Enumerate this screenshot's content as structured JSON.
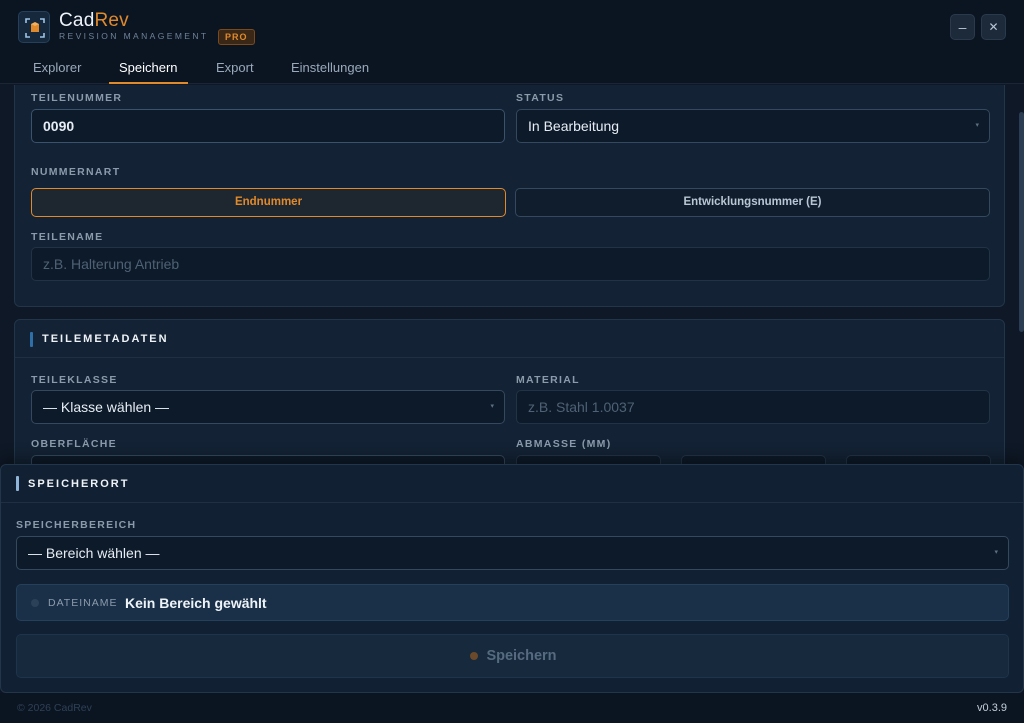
{
  "app": {
    "name_primary": "Cad",
    "name_accent": "Rev",
    "subtitle": "REVISION MANAGEMENT",
    "badge": "PRO"
  },
  "window": {
    "minimize": "–",
    "close": "✕"
  },
  "tabs": [
    {
      "label": "Explorer",
      "active": false
    },
    {
      "label": "Speichern",
      "active": true
    },
    {
      "label": "Export",
      "active": false
    },
    {
      "label": "Einstellungen",
      "active": false
    }
  ],
  "part": {
    "number_label": "TEILENUMMER",
    "number_value": "0090",
    "status_label": "STATUS",
    "status_value": "In Bearbeitung",
    "numtype_label": "NUMMERNART",
    "numtype_options": [
      "Endnummer",
      "Entwicklungsnummer (E)"
    ],
    "numtype_selected": "Endnummer",
    "name_label": "TEILENAME",
    "name_placeholder": "z.B. Halterung Antrieb"
  },
  "metadata": {
    "title": "TEILEMETADATEN",
    "class_label": "TEILEKLASSE",
    "class_value": "— Klasse wählen —",
    "material_label": "MATERIAL",
    "material_placeholder": "z.B. Stahl 1.0037",
    "surface_label": "OBERFLÄCHE",
    "dimensions_label": "ABMASSE (MM)"
  },
  "storage": {
    "title": "SPEICHERORT",
    "area_label": "SPEICHERBEREICH",
    "area_value": "— Bereich wählen —",
    "filename_label": "DATEINAME",
    "filename_value": "Kein Bereich gewählt",
    "save_label": "Speichern"
  },
  "footer": {
    "copyright": "© 2026 CadRev",
    "version": "v0.3.9"
  },
  "colors": {
    "accent": "#e08a2c",
    "background": "#0e1826",
    "card": "#132234"
  }
}
